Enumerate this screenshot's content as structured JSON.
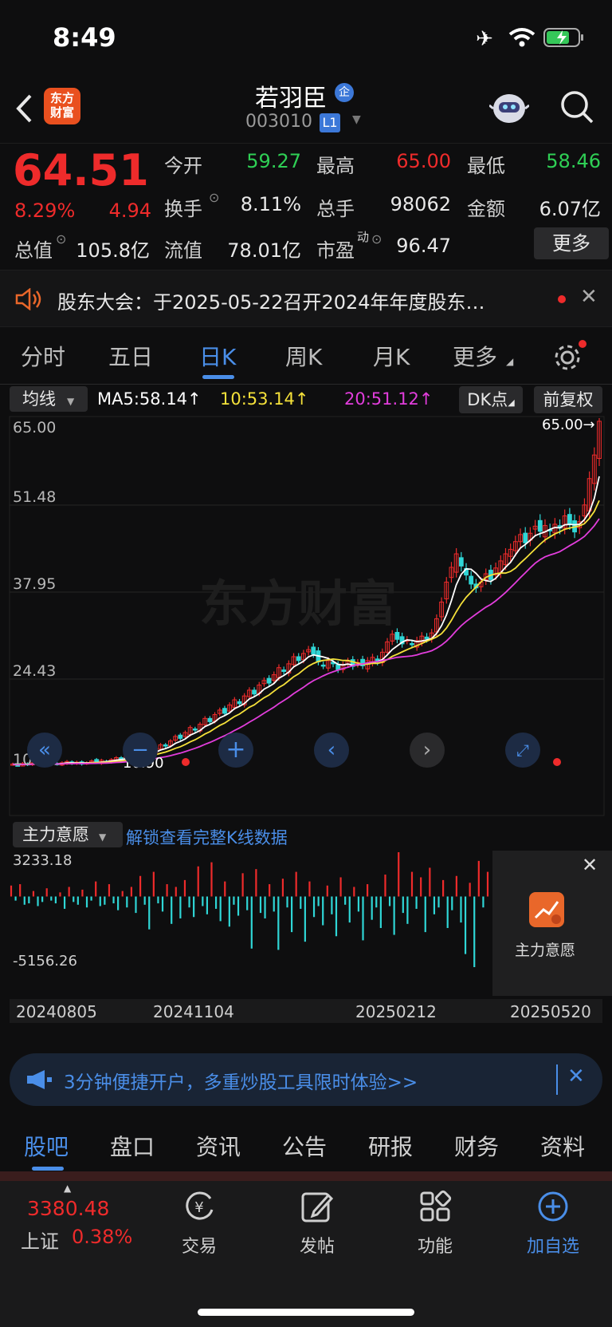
{
  "status": {
    "time": "8:49"
  },
  "header": {
    "name": "若羽臣",
    "badge": "企",
    "code": "003010",
    "level": "L1",
    "logo_text_1": "东方",
    "logo_text_2": "财富"
  },
  "quote": {
    "price": "64.51",
    "change_pct": "8.29%",
    "change": "4.94",
    "open_label": "今开",
    "open": "59.27",
    "high_label": "最高",
    "high": "65.00",
    "low_label": "最低",
    "low": "58.46",
    "turnover_label": "换手",
    "turnover": "8.11%",
    "volume_label": "总手",
    "volume": "98062",
    "amount_label": "金额",
    "amount": "6.07亿",
    "mktcap_label": "总值",
    "mktcap": "105.8亿",
    "float_label": "流值",
    "float": "78.01亿",
    "pe_label": "市盈",
    "pe_sup": "动",
    "pe": "96.47",
    "more_button": "更多"
  },
  "notice": {
    "text": "股东大会：于2025-05-22召开2024年年度股东…"
  },
  "tabs": {
    "items": [
      "分时",
      "五日",
      "日K",
      "周K",
      "月K",
      "更多"
    ],
    "active": 2
  },
  "ma": {
    "selector": "均线",
    "ma5": "MA5:58.14",
    "ma10": "10:53.14",
    "ma20": "20:51.12",
    "dk": "DK点",
    "adjust": "前复权",
    "ma5_color": "#ffffff",
    "ma10_color": "#f5e13a",
    "ma20_color": "#e23ddc"
  },
  "chart_data": {
    "type": "candlestick",
    "y_ticks": [
      "65.00",
      "51.48",
      "37.95",
      "24.43",
      "10.90"
    ],
    "ylim": [
      10.9,
      65.0
    ],
    "max_label": "65.00",
    "min_label": "10.90",
    "watermark": "东方财富",
    "closes": [
      11.2,
      11.0,
      11.3,
      11.1,
      11.4,
      11.2,
      11.0,
      11.3,
      11.5,
      11.2,
      11.4,
      11.6,
      11.3,
      11.5,
      11.2,
      11.4,
      11.7,
      11.5,
      11.8,
      11.6,
      11.9,
      12.2,
      12.0,
      12.4,
      12.8,
      12.5,
      12.9,
      13.3,
      13.0,
      13.6,
      14.2,
      14.0,
      14.8,
      15.5,
      15.2,
      16.1,
      16.9,
      16.5,
      17.4,
      18.3,
      17.8,
      18.9,
      19.6,
      19.1,
      20.4,
      21.2,
      20.6,
      21.8,
      22.7,
      22.1,
      23.5,
      24.2,
      23.8,
      25.1,
      26.2,
      25.6,
      26.8,
      27.9,
      27.3,
      28.4,
      29.0,
      28.3,
      27.1,
      26.5,
      27.3,
      26.8,
      25.9,
      26.6,
      27.2,
      26.4,
      27.0,
      26.5,
      27.3,
      27.8,
      27.1,
      28.6,
      30.2,
      31.4,
      30.6,
      29.9,
      30.5,
      29.8,
      30.4,
      31.1,
      30.7,
      31.6,
      33.8,
      36.4,
      39.5,
      41.8,
      43.9,
      42.0,
      40.6,
      39.2,
      38.6,
      39.5,
      40.8,
      39.9,
      41.7,
      42.8,
      43.9,
      44.6,
      45.8,
      46.9,
      45.6,
      47.1,
      48.2,
      47.4,
      48.3,
      47.6,
      48.5,
      47.9,
      49.8,
      48.6,
      47.3,
      48.9,
      51.5,
      55.6,
      59.27,
      64.51
    ]
  },
  "indicator": {
    "selector": "主力意愿",
    "unlock": "解锁查看完整K线数据",
    "max": "3233.18",
    "min": "-5156.26",
    "card_label": "主力意愿",
    "dates": [
      "20240805",
      "20241104",
      "20250212",
      "20250520"
    ],
    "values": [
      800,
      -300,
      900,
      -600,
      -500,
      400,
      -700,
      -400,
      600,
      -300,
      -500,
      300,
      -900,
      700,
      -400,
      -600,
      500,
      -800,
      -300,
      1100,
      -700,
      -600,
      900,
      -500,
      -1000,
      400,
      -800,
      700,
      -1200,
      1500,
      -600,
      -2400,
      1800,
      -500,
      -1100,
      900,
      -2000,
      700,
      -1600,
      1200,
      -800,
      -1500,
      2200,
      -700,
      -1300,
      2500,
      -900,
      -1800,
      1100,
      -2200,
      -600,
      -1400,
      1700,
      -1000,
      -3800,
      2000,
      -1200,
      -1600,
      900,
      -1100,
      -3900,
      1300,
      -800,
      -2600,
      1800,
      -900,
      -3300,
      1100,
      -1500,
      -700,
      -2100,
      800,
      -1300,
      -2900,
      1400,
      -600,
      -1900,
      700,
      -1100,
      -3200,
      900,
      -1700,
      -800,
      -2300,
      1600,
      -700,
      -2800,
      3233,
      -1200,
      -2000,
      1800,
      -900,
      1400,
      -2600,
      2100,
      -1300,
      -800,
      1200,
      -2300,
      -1000,
      1500,
      -1900,
      -4200,
      1000,
      -5156,
      2600,
      -800,
      1800
    ]
  },
  "banner": {
    "text": "3分钟便捷开户，多重炒股工具限时体验>>"
  },
  "bottom_tabs": {
    "items": [
      "股吧",
      "盘口",
      "资讯",
      "公告",
      "研报",
      "财务",
      "资料"
    ],
    "active": 0
  },
  "tabbar": {
    "index_value": "3380.48",
    "index_name": "上证",
    "index_pct": "0.38%",
    "trade": "交易",
    "post": "发帖",
    "func": "功能",
    "watch": "加自选"
  }
}
